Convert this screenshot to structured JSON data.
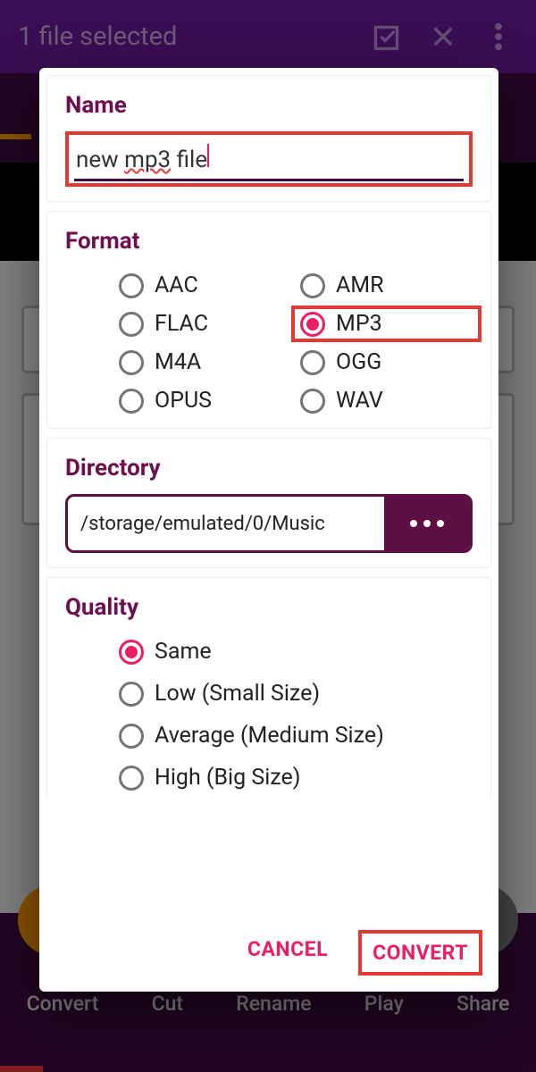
{
  "appbar": {
    "title": "1 file selected"
  },
  "bottom": {
    "labels": [
      "Convert",
      "Cut",
      "Rename",
      "Play",
      "Share"
    ]
  },
  "dialog": {
    "name": {
      "title": "Name",
      "value": "new mp3 file"
    },
    "format": {
      "title": "Format",
      "options": [
        "AAC",
        "AMR",
        "FLAC",
        "MP3",
        "M4A",
        "OGG",
        "OPUS",
        "WAV"
      ],
      "selected": "MP3"
    },
    "directory": {
      "title": "Directory",
      "path": "/storage/emulated/0/Music"
    },
    "quality": {
      "title": "Quality",
      "options": [
        "Same",
        "Low (Small Size)",
        "Average (Medium Size)",
        "High (Big Size)"
      ],
      "selected": "Same"
    },
    "actions": {
      "cancel": "CANCEL",
      "convert": "CONVERT"
    }
  }
}
